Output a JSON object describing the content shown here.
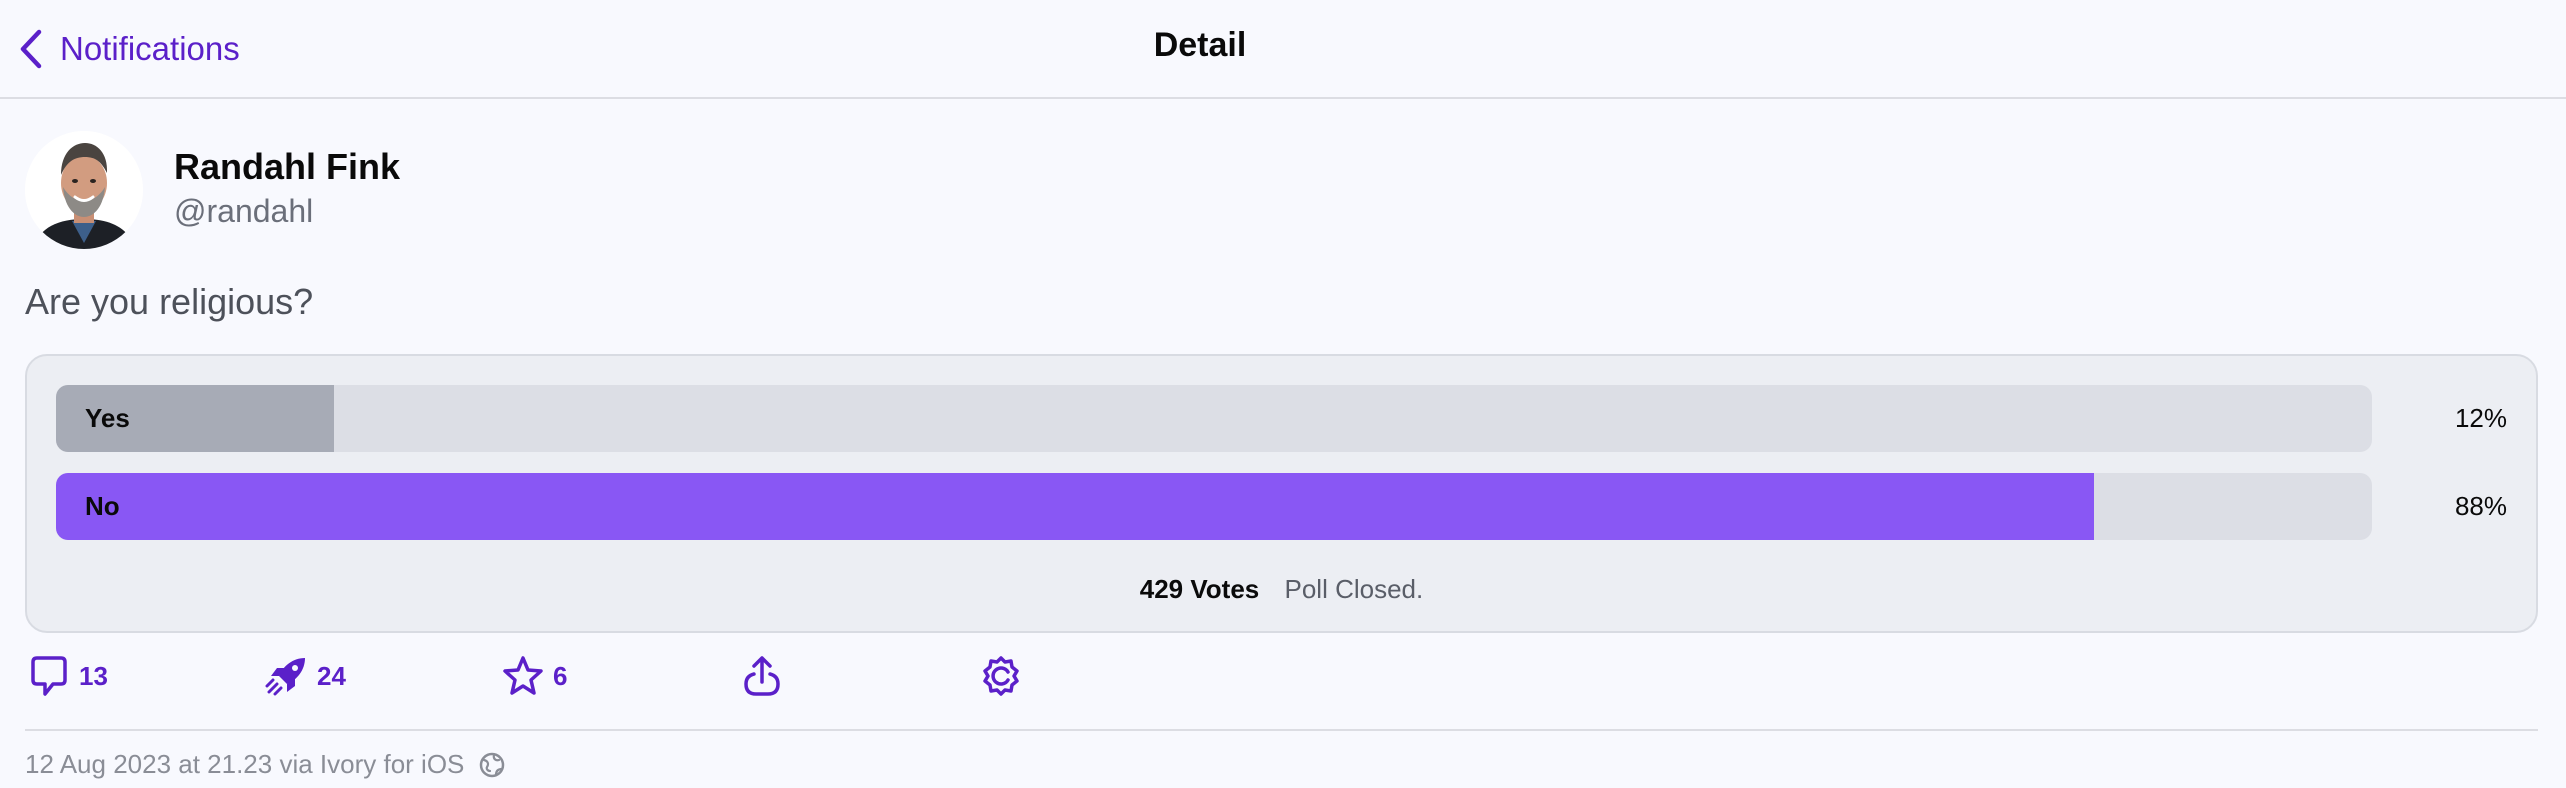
{
  "header": {
    "back_label": "Notifications",
    "title": "Detail"
  },
  "author": {
    "name": "Randahl Fink",
    "handle": "@randahl"
  },
  "post": {
    "text": "Are you religious?"
  },
  "poll": {
    "options": [
      {
        "label": "Yes",
        "percent_text": "12%",
        "fraction": 0.12,
        "fill_color": "#a7abb6"
      },
      {
        "label": "No",
        "percent_text": "88%",
        "fraction": 0.88,
        "fill_color": "#8957f4"
      }
    ],
    "votes": "429 Votes",
    "status": "Poll Closed."
  },
  "actions": {
    "replies": {
      "icon": "reply-icon",
      "count": "13"
    },
    "boosts": {
      "icon": "rocket-boost-icon",
      "count": "24"
    },
    "favorites": {
      "icon": "star-icon",
      "count": "6"
    },
    "share": {
      "icon": "share-icon"
    },
    "more": {
      "icon": "gear-icon"
    }
  },
  "meta": {
    "timestamp": "12 Aug 2023 at 21.23 via Ivory for iOS",
    "visibility_icon": "globe-icon"
  },
  "colors": {
    "accent": "#5b20c9",
    "poll_winner": "#8957f4",
    "poll_other": "#a7abb6"
  }
}
